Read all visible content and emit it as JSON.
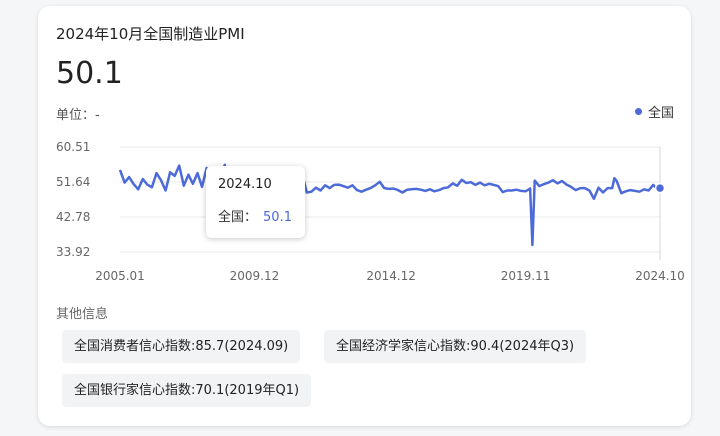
{
  "title": "2024年10月全国制造业PMI",
  "current_value": "50.1",
  "unit_label": "单位：-",
  "colors": {
    "series": "#4d6bd8",
    "grid": "#e8e8e8",
    "cursor": "#d5d5d5"
  },
  "chart_data": {
    "type": "line",
    "series": [
      {
        "name": "全国",
        "points": [
          [
            "2005.01",
            54.7
          ],
          [
            "2005.03",
            51.5
          ],
          [
            "2005.05",
            52.9
          ],
          [
            "2005.07",
            51.1
          ],
          [
            "2005.09",
            49.8
          ],
          [
            "2005.11",
            52.4
          ],
          [
            "2006.01",
            51.0
          ],
          [
            "2006.03",
            50.3
          ],
          [
            "2006.05",
            53.9
          ],
          [
            "2006.07",
            52.1
          ],
          [
            "2006.09",
            49.5
          ],
          [
            "2006.11",
            54.1
          ],
          [
            "2007.01",
            53.2
          ],
          [
            "2007.03",
            55.8
          ],
          [
            "2007.05",
            50.7
          ],
          [
            "2007.07",
            53.5
          ],
          [
            "2007.09",
            51.2
          ],
          [
            "2007.11",
            53.9
          ],
          [
            "2008.01",
            50.4
          ],
          [
            "2008.03",
            55.2
          ],
          [
            "2008.05",
            51.1
          ],
          [
            "2008.07",
            53.0
          ],
          [
            "2008.09",
            52.8
          ],
          [
            "2008.11",
            56.0
          ],
          [
            "2009.01",
            38.8
          ],
          [
            "2009.03",
            42.8
          ],
          [
            "2009.05",
            47.5
          ],
          [
            "2009.07",
            49.8
          ],
          [
            "2009.09",
            51.8
          ],
          [
            "2009.11",
            50.3
          ],
          [
            "2010.01",
            52.0
          ],
          [
            "2010.03",
            48.5
          ],
          [
            "2010.05",
            50.9
          ],
          [
            "2010.07",
            49.5
          ],
          [
            "2010.09",
            51.0
          ],
          [
            "2010.11",
            50.2
          ],
          [
            "2011.01",
            49.8
          ],
          [
            "2011.03",
            50.6
          ],
          [
            "2011.05",
            48.8
          ],
          [
            "2011.07",
            52.1
          ],
          [
            "2011.09",
            53.6
          ],
          [
            "2011.11",
            49.0
          ],
          [
            "2012.01",
            49.2
          ],
          [
            "2012.03",
            50.2
          ],
          [
            "2012.05",
            49.5
          ],
          [
            "2012.07",
            50.8
          ],
          [
            "2012.09",
            50.1
          ],
          [
            "2012.11",
            50.9
          ],
          [
            "2013.01",
            51.0
          ],
          [
            "2013.03",
            50.6
          ],
          [
            "2013.05",
            50.2
          ],
          [
            "2013.07",
            50.8
          ],
          [
            "2013.09",
            49.6
          ],
          [
            "2013.11",
            49.2
          ],
          [
            "2014.01",
            49.7
          ],
          [
            "2014.03",
            50.1
          ],
          [
            "2014.05",
            50.8
          ],
          [
            "2014.07",
            51.7
          ],
          [
            "2014.09",
            50.1
          ],
          [
            "2014.11",
            49.9
          ],
          [
            "2015.01",
            50.0
          ],
          [
            "2015.03",
            49.6
          ],
          [
            "2015.05",
            49.0
          ],
          [
            "2015.07",
            49.7
          ],
          [
            "2015.09",
            49.8
          ],
          [
            "2015.11",
            49.9
          ],
          [
            "2016.01",
            49.7
          ],
          [
            "2016.03",
            49.4
          ],
          [
            "2016.05",
            49.8
          ],
          [
            "2016.07",
            49.3
          ],
          [
            "2016.09",
            49.6
          ],
          [
            "2016.11",
            50.1
          ],
          [
            "2017.01",
            50.3
          ],
          [
            "2017.03",
            51.3
          ],
          [
            "2017.05",
            50.7
          ],
          [
            "2017.07",
            52.2
          ],
          [
            "2017.09",
            51.4
          ],
          [
            "2017.11",
            51.6
          ],
          [
            "2018.01",
            50.9
          ],
          [
            "2018.03",
            51.5
          ],
          [
            "2018.05",
            50.8
          ],
          [
            "2018.07",
            51.2
          ],
          [
            "2018.09",
            50.9
          ],
          [
            "2018.11",
            50.6
          ],
          [
            "2019.01",
            49.1
          ],
          [
            "2019.03",
            49.5
          ],
          [
            "2019.05",
            49.5
          ],
          [
            "2019.07",
            49.7
          ],
          [
            "2019.09",
            49.4
          ],
          [
            "2019.11",
            49.3
          ],
          [
            "2020.01",
            50.0
          ],
          [
            "2020.02",
            35.7
          ],
          [
            "2020.03",
            52.0
          ],
          [
            "2020.05",
            50.6
          ],
          [
            "2020.07",
            51.1
          ],
          [
            "2020.09",
            51.5
          ],
          [
            "2020.11",
            52.1
          ],
          [
            "2021.01",
            51.3
          ],
          [
            "2021.03",
            51.9
          ],
          [
            "2021.05",
            51.0
          ],
          [
            "2021.07",
            50.4
          ],
          [
            "2021.09",
            49.6
          ],
          [
            "2021.11",
            50.1
          ],
          [
            "2022.01",
            50.1
          ],
          [
            "2022.03",
            49.5
          ],
          [
            "2022.05",
            47.4
          ],
          [
            "2022.07",
            50.2
          ],
          [
            "2022.09",
            49.0
          ],
          [
            "2022.11",
            50.1
          ],
          [
            "2023.01",
            50.1
          ],
          [
            "2023.02",
            52.6
          ],
          [
            "2023.03",
            51.9
          ],
          [
            "2023.05",
            48.8
          ],
          [
            "2023.07",
            49.3
          ],
          [
            "2023.09",
            49.6
          ],
          [
            "2023.11",
            49.4
          ],
          [
            "2024.01",
            49.2
          ],
          [
            "2024.03",
            49.8
          ],
          [
            "2024.05",
            49.5
          ],
          [
            "2024.07",
            50.9
          ],
          [
            "2024.09",
            49.8
          ],
          [
            "2024.10",
            50.1
          ]
        ]
      }
    ],
    "x_ticks": [
      "2005.01",
      "2009.12",
      "2014.12",
      "2019.11",
      "2024.10"
    ],
    "y_ticks": [
      "60.51",
      "51.64",
      "42.78",
      "33.92"
    ],
    "ylim": [
      33.92,
      60.51
    ],
    "xlim": [
      "2005.01",
      "2024.10"
    ],
    "grid": true,
    "legend_position": "top-right",
    "tooltip": {
      "date": "2024.10",
      "series_label": "全国：",
      "value": "50.1"
    }
  },
  "other_info": {
    "heading": "其他信息",
    "items": [
      "全国消费者信心指数:85.7(2024.09)",
      "全国经济学家信心指数:90.4(2024年Q3)",
      "全国银行家信心指数:70.1(2019年Q1)"
    ]
  }
}
